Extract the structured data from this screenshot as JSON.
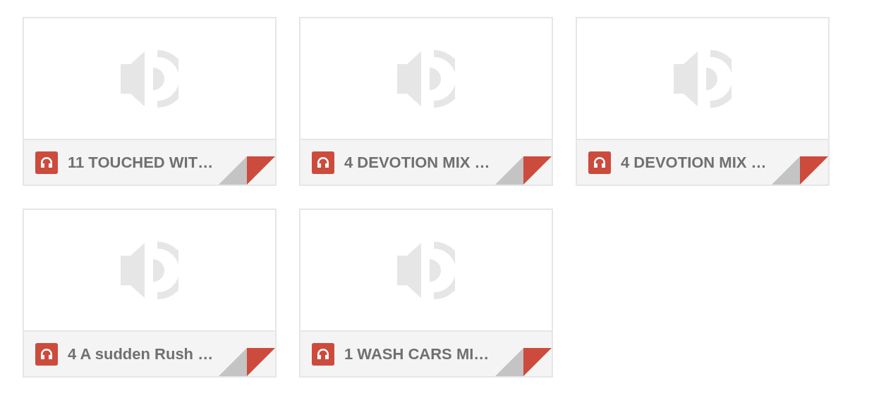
{
  "files": [
    {
      "title": "11 TOUCHED WIT…"
    },
    {
      "title": "4 DEVOTION MIX …"
    },
    {
      "title": "4 DEVOTION MIX …"
    },
    {
      "title": "4 A sudden Rush …"
    },
    {
      "title": "1 WASH CARS MI…"
    }
  ]
}
